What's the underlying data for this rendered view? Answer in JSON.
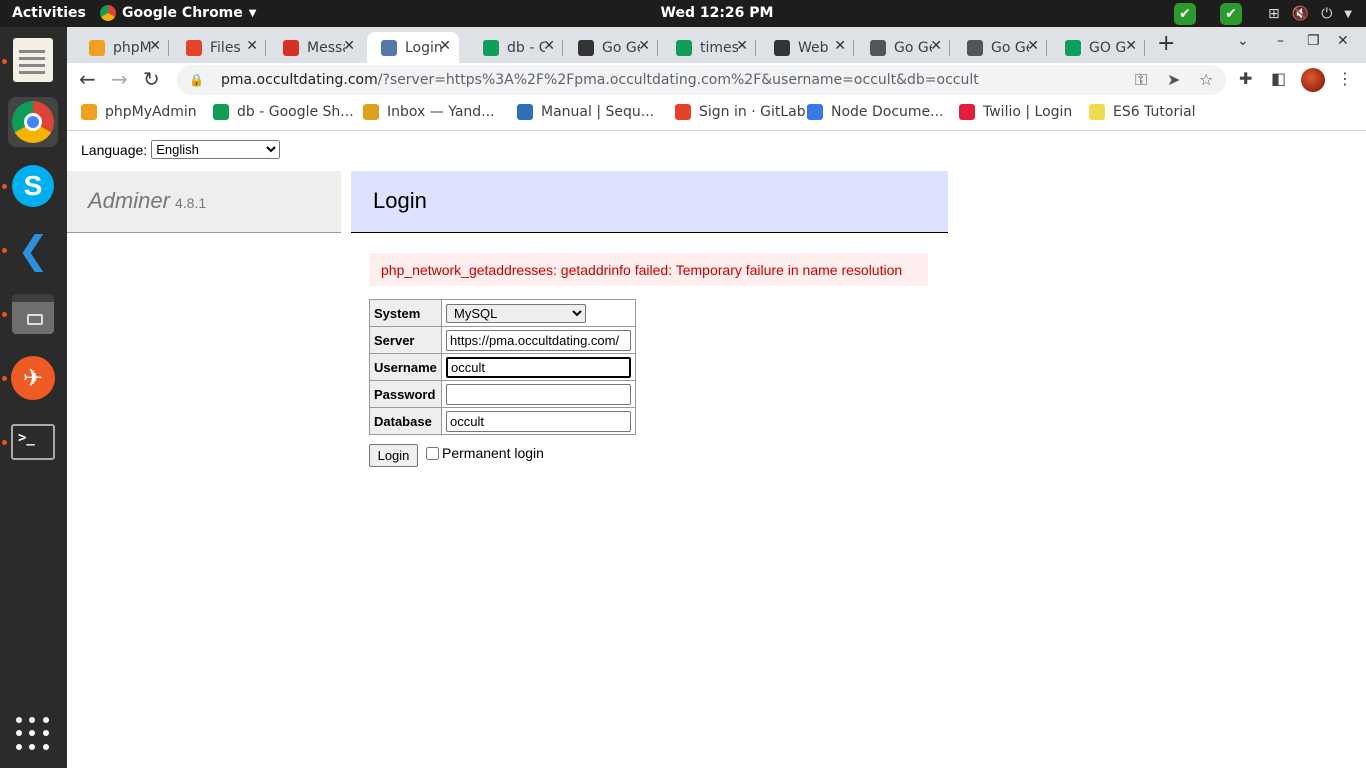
{
  "system": {
    "activities": "Activities",
    "app_name": "Google Chrome",
    "clock": "Wed 12:26 PM"
  },
  "browser": {
    "tabs": [
      {
        "title": "phpMyAdmin",
        "icon": "pma-icon",
        "color": "#f0a020"
      },
      {
        "title": "Files",
        "icon": "gitlab-icon",
        "color": "#e24329"
      },
      {
        "title": "Messages",
        "icon": "gmail-icon",
        "color": "#d93025"
      },
      {
        "title": "Login",
        "icon": "adminer-icon",
        "color": "#5577aa"
      },
      {
        "title": "db - Google Sheets",
        "icon": "sheets-icon",
        "color": "#0f9d58"
      },
      {
        "title": "Go Get",
        "icon": "go-icon",
        "color": "#333333"
      },
      {
        "title": "timesheet",
        "icon": "sheets-icon",
        "color": "#0f9d58"
      },
      {
        "title": "Web",
        "icon": "go-icon",
        "color": "#333333"
      },
      {
        "title": "Go Get",
        "icon": "gopher-icon",
        "color": "#555555"
      },
      {
        "title": "Go Get",
        "icon": "gopher-icon",
        "color": "#555555"
      },
      {
        "title": "GO Get",
        "icon": "sheets-icon",
        "color": "#0f9d58"
      }
    ],
    "url_host": "pma.occultdating.com",
    "url_path": "/?server=https%3A%2F%2Fpma.occultdating.com%2F&username=occult&db=occult",
    "bookmarks": [
      {
        "label": "phpMyAdmin",
        "icon": "pma-icon",
        "color": "#f0a020"
      },
      {
        "label": "db - Google Sh...",
        "icon": "sheets-icon",
        "color": "#0f9d58"
      },
      {
        "label": "Inbox — Yand...",
        "icon": "mail-icon",
        "color": "#e0a020"
      },
      {
        "label": "Manual | Sequ...",
        "icon": "sequelize-icon",
        "color": "#2f6fb5"
      },
      {
        "label": "Sign in · GitLab",
        "icon": "gitlab-icon",
        "color": "#e24329"
      },
      {
        "label": "Node Docume...",
        "icon": "doc-icon",
        "color": "#3b78e7"
      },
      {
        "label": "Twilio | Login",
        "icon": "twilio-icon",
        "color": "#e31e3c"
      },
      {
        "label": "ES6 Tutorial",
        "icon": "js-icon",
        "color": "#f0db4f"
      }
    ]
  },
  "page": {
    "language_label": "Language:",
    "language_value": "English",
    "brand": "Adminer",
    "version": "4.8.1",
    "title": "Login",
    "error": "php_network_getaddresses: getaddrinfo failed: Temporary failure in name resolution",
    "form": {
      "system_label": "System",
      "system_value": "MySQL",
      "server_label": "Server",
      "server_value": "https://pma.occultdating.com/",
      "username_label": "Username",
      "username_value": "occult",
      "password_label": "Password",
      "password_value": "",
      "database_label": "Database",
      "database_value": "occult"
    },
    "login_button": "Login",
    "permanent_label": "Permanent login"
  }
}
